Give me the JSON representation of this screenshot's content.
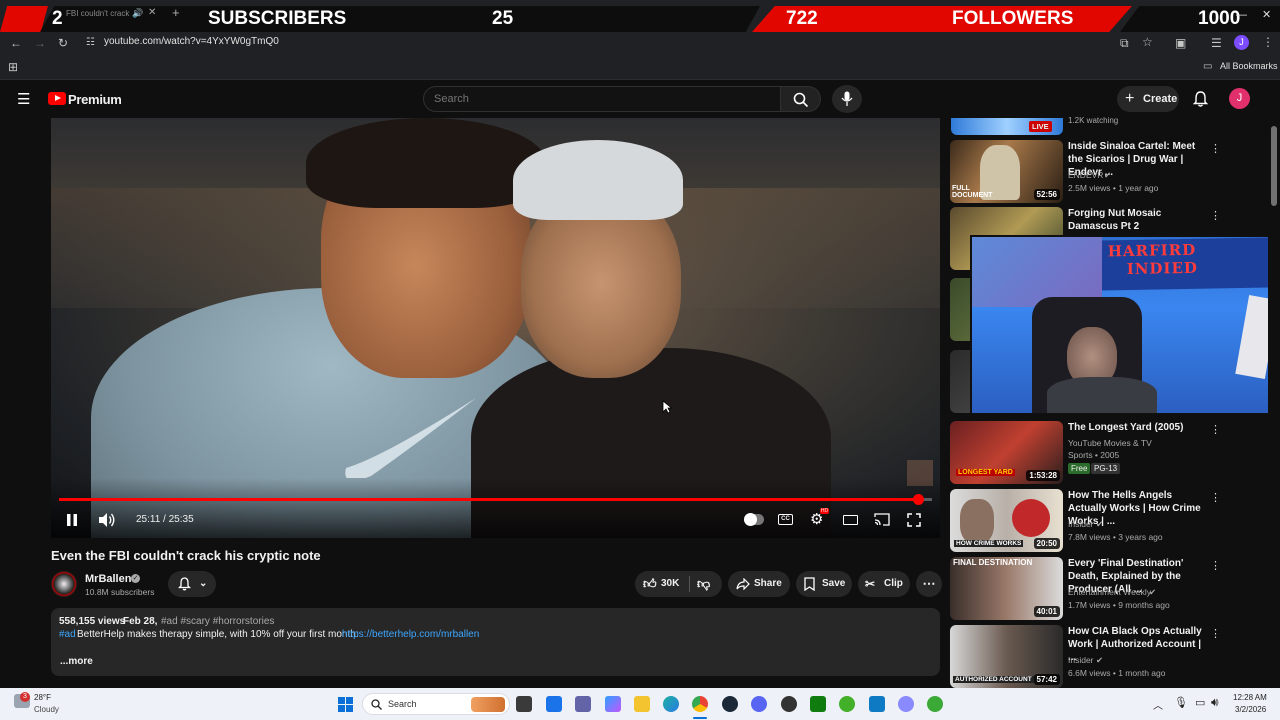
{
  "overlay": {
    "subs_current": "2",
    "subs_label": "SUBSCRIBERS",
    "subs_goal": "25",
    "followers_current": "722",
    "followers_label": "FOLLOWERS",
    "followers_goal": "1000",
    "tab_title": "FBI couldn't crack"
  },
  "browser": {
    "url": "youtube.com/watch?v=4YxYW0gTmQ0",
    "bookmarks": "All Bookmarks",
    "profile_initial": "J"
  },
  "youtube": {
    "logo_text": "Premium",
    "search_placeholder": "Search",
    "create_label": "Create",
    "avatar_initial": "J"
  },
  "player": {
    "time": "25:11 / 25:35",
    "progress": 0.984,
    "accent": "#ff0000"
  },
  "video": {
    "title": "Even the FBI couldn't crack his cryptic note",
    "channel": "MrBallen",
    "subscribers": "10.8M subscribers",
    "likes": "30K",
    "share": "Share",
    "save": "Save",
    "clip": "Clip",
    "views": "558,155 views",
    "date": "Feb 28,",
    "tags": "#ad #scary #horrorstories",
    "desc_tag": "#ad",
    "desc_text": "BetterHelp makes therapy simple, with 10% off your first month:",
    "desc_link": "https://betterhelp.com/mrballen",
    "more": "...more"
  },
  "sidebar": {
    "top": {
      "watching": "1.2K watching",
      "live": "LIVE"
    },
    "items": [
      {
        "title": "Inside Sinaloa Cartel: Meet the Sicarios | Drug War | Endevr ...",
        "channel": "ENDEVR",
        "meta": "2.5M views • 1 year ago",
        "duration": "52:56"
      },
      {
        "title": "Forging Nut Mosaic Damascus Pt 2",
        "channel": "",
        "meta": "",
        "duration": ""
      },
      {
        "title": "The Longest Yard (2005)",
        "channel": "YouTube Movies & TV",
        "meta": "Sports • 2005",
        "badge1": "Free",
        "badge2": "PG-13",
        "duration": "1:53:28"
      },
      {
        "title": "How The Hells Angels Actually Works | How Crime Works | ...",
        "channel": "Insider",
        "meta": "7.8M views • 3 years ago",
        "duration": "20:50"
      },
      {
        "title": "Every 'Final Destination' Death, Explained by the Producer (All ...",
        "channel": "Entertainment Weekly",
        "meta": "1.7M views • 9 months ago",
        "duration": "40:01"
      },
      {
        "title": "How CIA Black Ops Actually Work | Authorized Account | ...",
        "channel": "Insider",
        "meta": "6.6M views • 1 month ago",
        "duration": "57:42"
      }
    ]
  },
  "taskbar": {
    "temp": "28°F",
    "weather": "Cloudy",
    "search": "Search",
    "time": "12:28 AM",
    "date": "3/2/2026",
    "weather_badge": "3"
  }
}
